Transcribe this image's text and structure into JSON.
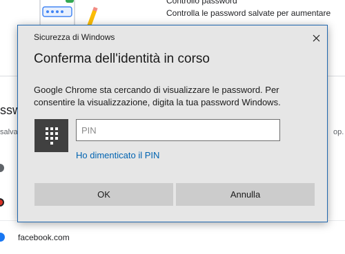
{
  "background": {
    "password_check_title": "Controllo password",
    "password_check_desc": "Controlla le password salvate per aumentare",
    "password_check_desc2": "",
    "section_heading": "sswo",
    "section_sub_left": "salva",
    "section_sub_right": "op.",
    "site_row_label": "facebook.com"
  },
  "dialog": {
    "window_title": "Sicurezza di Windows",
    "heading": "Conferma dell'identità in corso",
    "message": "Google Chrome sta cercando di visualizzare le password. Per consentire la visualizzazione, digita la tua password Windows.",
    "pin_placeholder": "PIN",
    "pin_value": "",
    "forgot_link": "Ho dimenticato il PIN",
    "ok_label": "OK",
    "cancel_label": "Annulla",
    "icons": {
      "close": "close-icon",
      "pin": "keypad-icon"
    }
  },
  "colors": {
    "dialog_bg": "#e6e6e6",
    "dialog_border": "#1f66ae",
    "link": "#0063b1",
    "button_bg": "#cccccc",
    "pin_tile": "#404040"
  }
}
